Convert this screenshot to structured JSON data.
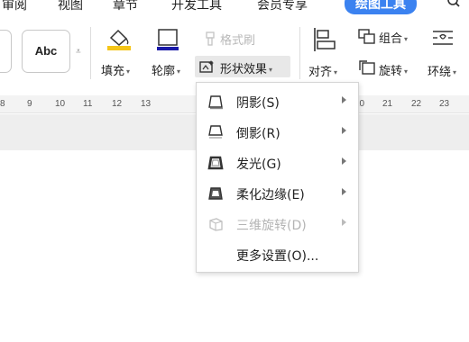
{
  "tabs": [
    {
      "label": "审阅"
    },
    {
      "label": "视图"
    },
    {
      "label": "章节"
    },
    {
      "label": "开发工具"
    },
    {
      "label": "会员专享"
    },
    {
      "label": "绘图工具"
    }
  ],
  "ribbon": {
    "style_sample": "Abc",
    "fill_label": "填充",
    "outline_label": "轮廓",
    "format_painter_label": "格式刷",
    "shape_effects_label": "形状效果",
    "align_label": "对齐",
    "group_label": "组合",
    "rotate_label": "旋转",
    "wrap_label": "环绕"
  },
  "ruler": {
    "ticks": [
      "8",
      "9",
      "10",
      "11",
      "12",
      "13",
      "20",
      "21",
      "22",
      "23"
    ]
  },
  "menu": {
    "items": [
      {
        "label": "阴影(S)",
        "icon": "shadow-icon",
        "submenu": true,
        "enabled": true
      },
      {
        "label": "倒影(R)",
        "icon": "reflection-icon",
        "submenu": true,
        "enabled": true
      },
      {
        "label": "发光(G)",
        "icon": "glow-icon",
        "submenu": true,
        "enabled": true
      },
      {
        "label": "柔化边缘(E)",
        "icon": "soft-edges-icon",
        "submenu": true,
        "enabled": true
      },
      {
        "label": "三维旋转(D)",
        "icon": "3d-rotation-icon",
        "submenu": true,
        "enabled": false
      },
      {
        "label": "更多设置(O)...",
        "icon": "",
        "submenu": false,
        "enabled": true
      }
    ]
  },
  "colors": {
    "accent": "#3b82f0",
    "fill_swatch": "#f5c518",
    "outline_swatch": "#1a1aa8",
    "menu_border": "#d5d5d5"
  }
}
